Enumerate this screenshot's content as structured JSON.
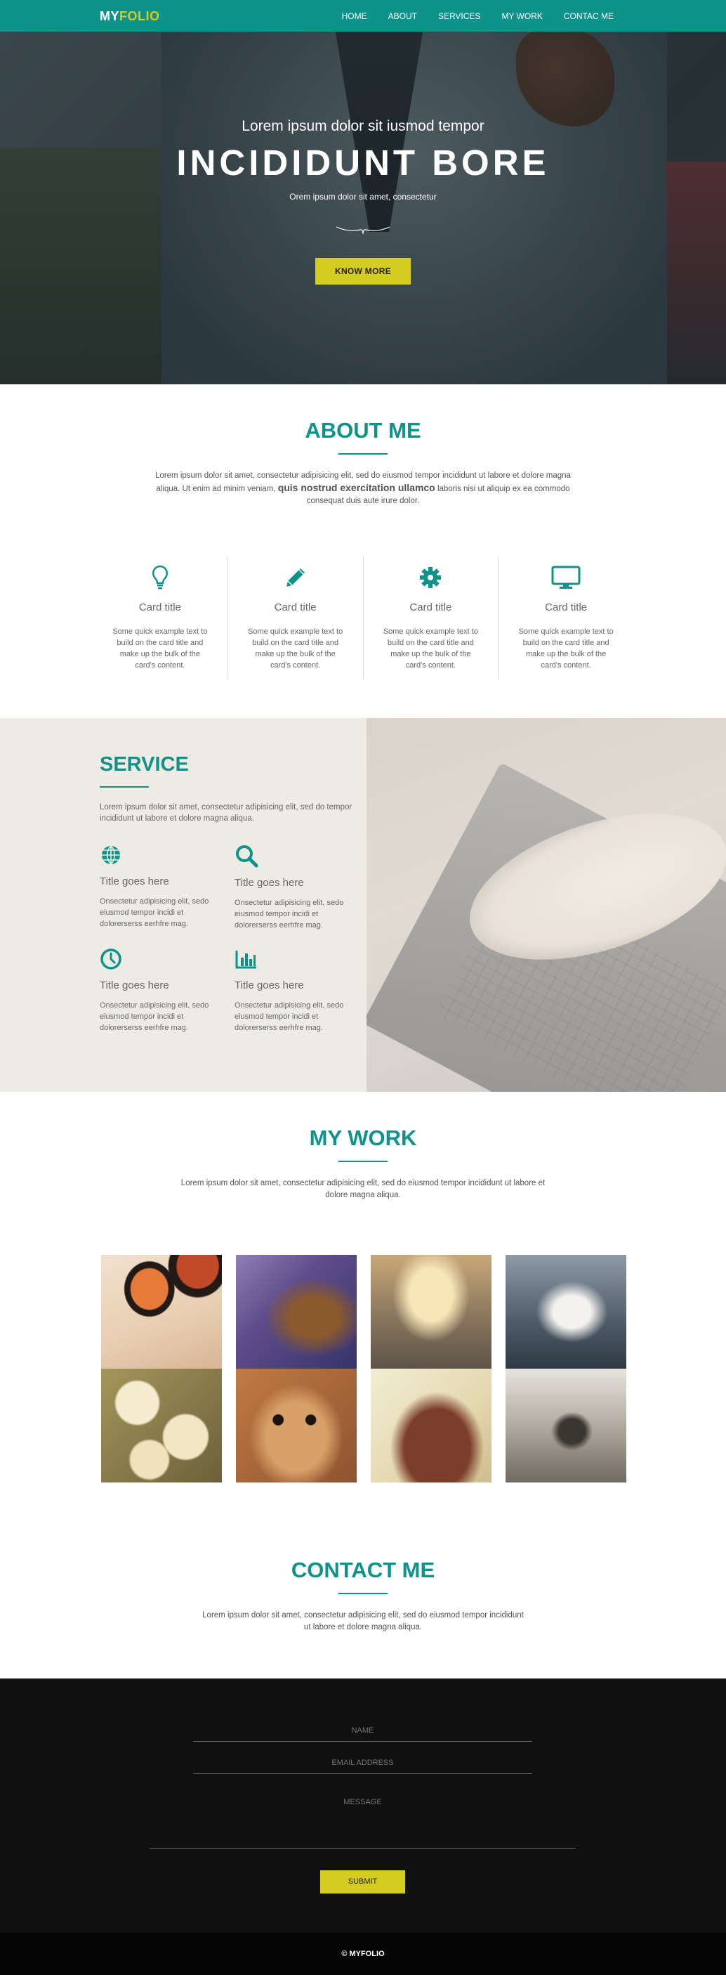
{
  "brand": {
    "logo_part1": "MY",
    "logo_part2": "FOLIO"
  },
  "nav": {
    "items": [
      "HOME",
      "ABOUT",
      "SERVICES",
      "MY WORK",
      "CONTAC ME"
    ]
  },
  "hero": {
    "kicker": "Lorem ipsum dolor sit iusmod tempor",
    "title": "INCIDIDUNT BORE",
    "subtitle": "Orem ipsum dolor sit amet, consectetur",
    "button": "KNOW MORE"
  },
  "about": {
    "title": "ABOUT ME",
    "text_before": "Lorem ipsum dolor sit amet, consectetur adipisicing elit, sed do eiusmod tempor incididunt ut labore et dolore magna aliqua. Ut enim ad minim veniam,",
    "text_strong": "quis nostrud exercitation ullamco",
    "text_after": "laboris nisi ut aliquip ex ea commodo consequat duis aute irure dolor.",
    "cards": [
      {
        "icon": "lightbulb-icon",
        "title": "Card title",
        "text": "Some quick example text to build on the card title and make up the bulk of the card's content."
      },
      {
        "icon": "pencil-icon",
        "title": "Card title",
        "text": "Some quick example text to build on the card title and make up the bulk of the card's content."
      },
      {
        "icon": "gear-icon",
        "title": "Card title",
        "text": "Some quick example text to build on the card title and make up the bulk of the card's content."
      },
      {
        "icon": "monitor-icon",
        "title": "Card title",
        "text": "Some quick example text to build on the card title and make up the bulk of the card's content."
      }
    ]
  },
  "service": {
    "title": "SERVICE",
    "intro": "Lorem ipsum dolor sit amet, consectetur adipisicing elit, sed do tempor incididunt ut labore et dolore magna aliqua.",
    "items": [
      {
        "icon": "globe-icon",
        "title": "Title goes here",
        "text": "Onsectetur adipisicing elit, sedo eiusmod tempor incidi et dolorerserss eerhfre mag."
      },
      {
        "icon": "search-icon",
        "title": "Title goes here",
        "text": "Onsectetur adipisicing elit, sedo eiusmod tempor incidi et dolorerserss eerhfre mag."
      },
      {
        "icon": "clock-icon",
        "title": "Title goes here",
        "text": "Onsectetur adipisicing elit, sedo eiusmod tempor incidi et dolorerserss eerhfre mag."
      },
      {
        "icon": "bar-chart-icon",
        "title": "Title goes here",
        "text": "Onsectetur adipisicing elit, sedo eiusmod tempor incidi et dolorerserss eerhfre mag."
      }
    ]
  },
  "work": {
    "title": "MY WORK",
    "text": "Lorem ipsum dolor sit amet, consectetur adipisicing elit, sed do eiusmod tempor incididunt ut labore et dolore magna aliqua."
  },
  "contact": {
    "title": "CONTACT ME",
    "text": "Lorem ipsum dolor sit amet, consectetur adipisicing elit, sed do eiusmod tempor incididunt ut labore et dolore magna aliqua.",
    "name_placeholder": "NAME",
    "email_placeholder": "EMAIL ADDRESS",
    "message_placeholder": "MESSAGE",
    "submit": "SUBMIT"
  },
  "footer": {
    "text": "© MYFOLIO"
  },
  "colors": {
    "primary": "#0e938a",
    "accent": "#d4cc1f",
    "dark": "#101010"
  }
}
